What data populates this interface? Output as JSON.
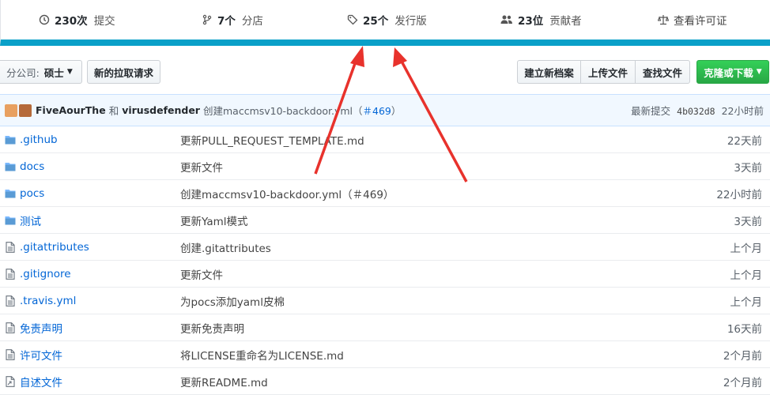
{
  "stats": {
    "commits": {
      "num": "230次",
      "label": "提交"
    },
    "branches": {
      "num": "7个",
      "label": "分店"
    },
    "releases": {
      "num": "25个",
      "label": "发行版"
    },
    "contributors": {
      "num": "23位",
      "label": "贡献者"
    },
    "license": {
      "label": "查看许可证"
    }
  },
  "toolbar": {
    "branch_prefix": "分公司:",
    "branch_name": "硕士",
    "pull_request": "新的拉取请求",
    "create_file": "建立新档案",
    "upload_file": "上传文件",
    "find_file": "查找文件",
    "clone_download": "克隆或下载"
  },
  "commit": {
    "author1": "FiveAourThe",
    "and": "和",
    "author2": "virusdefender",
    "message": "创建maccmsv10-backdoor.yml（",
    "pr": "＃469",
    "close": "）",
    "latest_label": "最新提交",
    "sha": "4b032d8",
    "age": "22小时前"
  },
  "files": [
    {
      "icon": "folder-icon",
      "name": ".github",
      "message": "更新PULL_REQUEST_TEMPLATE.md",
      "age": "22天前"
    },
    {
      "icon": "folder-icon",
      "name": "docs",
      "message": "更新文件",
      "age": "3天前"
    },
    {
      "icon": "folder-icon",
      "name": "pocs",
      "message": "创建maccmsv10-backdoor.yml（＃469）",
      "age": "22小时前"
    },
    {
      "icon": "folder-icon",
      "name": "测试",
      "message": "更新Yaml模式",
      "age": "3天前"
    },
    {
      "icon": "file-icon",
      "name": ".gitattributes",
      "message": "创建.gitattributes",
      "age": "上个月"
    },
    {
      "icon": "file-icon",
      "name": ".gitignore",
      "message": "更新文件",
      "age": "上个月"
    },
    {
      "icon": "file-icon",
      "name": ".travis.yml",
      "message": "为pocs添加yaml皮棉",
      "age": "上个月"
    },
    {
      "icon": "file-icon",
      "name": "免责声明",
      "message": "更新免责声明",
      "age": "16天前"
    },
    {
      "icon": "file-icon",
      "name": "许可文件",
      "message": "将LICENSE重命名为LICENSE.md",
      "age": "2个月前"
    },
    {
      "icon": "symlink-file-icon",
      "name": "自述文件",
      "message": "更新README.md",
      "age": "2个月前"
    }
  ],
  "colors": {
    "accent_bar": "#0aa0c8",
    "link": "#0366d6",
    "annotation_arrow": "#e8322c",
    "clone_button": "#28a745"
  }
}
